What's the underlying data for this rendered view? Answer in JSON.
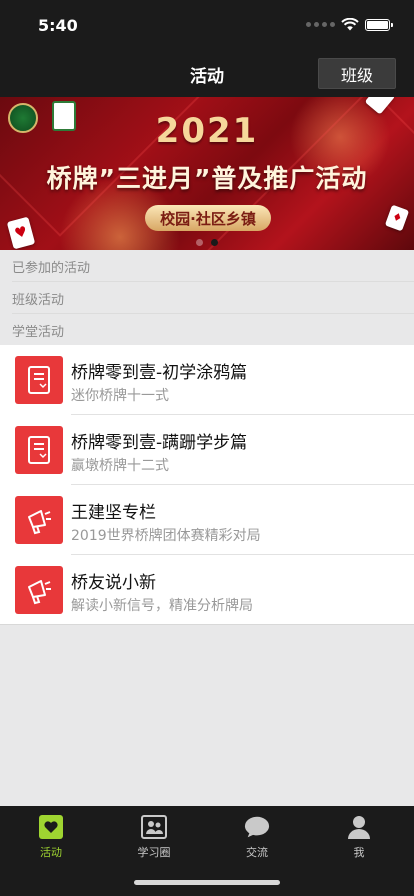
{
  "status_bar": {
    "time": "5:40"
  },
  "nav": {
    "title": "活动",
    "right_button": "班级"
  },
  "banner": {
    "year": "2021",
    "headline": "桥牌”三进月”普及推广活动",
    "pill": "校园·社区乡镇",
    "page_count": 2,
    "active_page": 2
  },
  "sections": [
    {
      "label": "已参加的活动"
    },
    {
      "label": "班级活动"
    },
    {
      "label": "学堂活动"
    }
  ],
  "items": [
    {
      "title": "桥牌零到壹-初学涂鸦篇",
      "subtitle": "迷你桥牌十一式",
      "icon": "book-icon"
    },
    {
      "title": "桥牌零到壹-蹒跚学步篇",
      "subtitle": "赢墩桥牌十二式",
      "icon": "book-icon"
    },
    {
      "title": "王建坚专栏",
      "subtitle": "2019世界桥牌团体赛精彩对局",
      "icon": "megaphone-icon"
    },
    {
      "title": "桥友说小新",
      "subtitle": "解读小新信号，精准分析牌局",
      "icon": "megaphone-icon"
    }
  ],
  "tabs": [
    {
      "label": "活动",
      "icon": "heart-icon",
      "active": true
    },
    {
      "label": "学习圈",
      "icon": "contacts-icon",
      "active": false
    },
    {
      "label": "交流",
      "icon": "chat-bubble-icon",
      "active": false
    },
    {
      "label": "我",
      "icon": "person-icon",
      "active": false
    }
  ],
  "colors": {
    "accent_green": "#9fd531",
    "item_icon_red": "#e8383a",
    "bar_dark": "#1b1b1b"
  }
}
